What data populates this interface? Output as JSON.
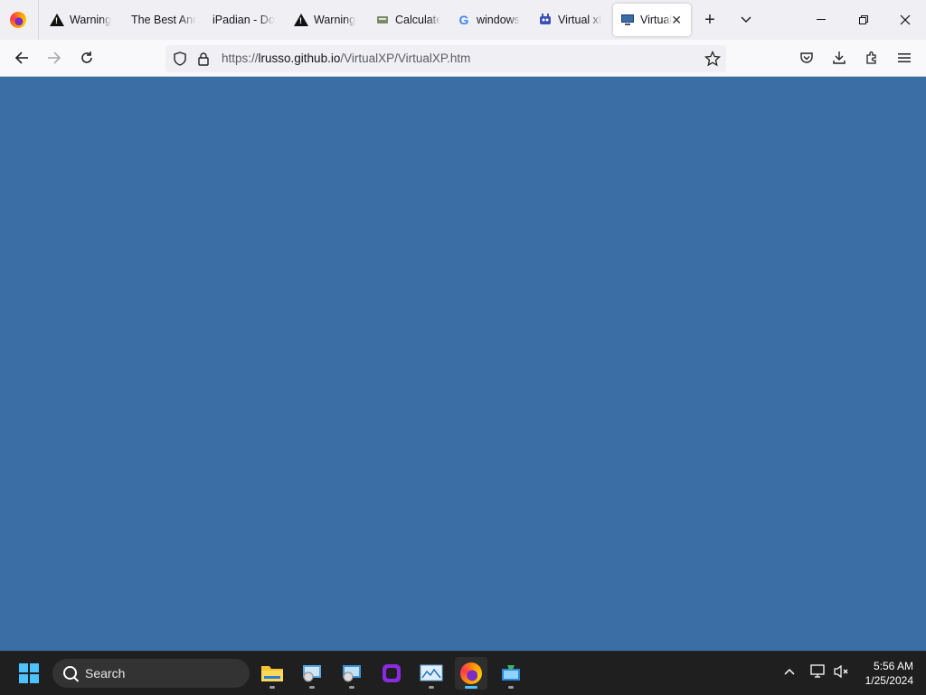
{
  "browser": {
    "tabs": [
      {
        "label": "Warning",
        "icon": "warning-icon"
      },
      {
        "label": "The Best And",
        "icon": ""
      },
      {
        "label": "iPadian - Do",
        "icon": ""
      },
      {
        "label": "Warning",
        "icon": "warning-icon"
      },
      {
        "label": "Calculate",
        "icon": "calculator-icon"
      },
      {
        "label": "windows",
        "icon": "google-icon"
      },
      {
        "label": "Virtual xP",
        "icon": "virtualxp-icon"
      },
      {
        "label": "Virtual",
        "icon": "monitor-icon",
        "active": true
      }
    ],
    "address": {
      "scheme": "https://",
      "host": "lrusso.github.io",
      "path": "/VirtualXP/VirtualXP.htm"
    }
  },
  "page": {
    "background": "#3a6ea5"
  },
  "taskbar": {
    "search_label": "Search",
    "time": "5:56 AM",
    "date": "1/25/2024"
  }
}
